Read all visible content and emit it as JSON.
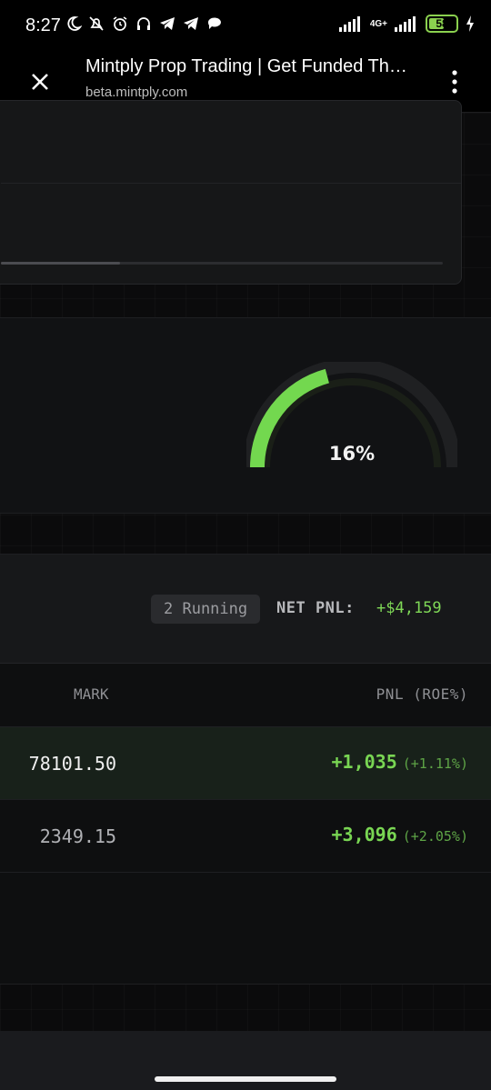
{
  "status_bar": {
    "time": "8:27",
    "battery_percent": "58",
    "network": "4G+",
    "icons": [
      "moon-icon",
      "mute-icon",
      "alarm-icon",
      "headset-icon",
      "telegram-icon",
      "telegram-icon",
      "chat-bubble-icon",
      "signal-icon",
      "signal-icon",
      "battery-icon",
      "charging-icon"
    ]
  },
  "browser": {
    "page_title": "Mintply Prop Trading | Get Funded Th…",
    "url": "beta.mintply.com",
    "icons": [
      "close-icon",
      "more-vert-icon"
    ]
  },
  "top_panel": {
    "progress_fraction": 0.27
  },
  "gauge": {
    "value_label": "16%",
    "value_fraction": 0.16,
    "accent_color": "#73d84f"
  },
  "positions": {
    "running_badge": "2 Running",
    "net_pnl_label": "NET PNL:",
    "net_pnl_value": "+$4,159",
    "columns": {
      "mark": "MARK",
      "pnl": "PNL (ROE%)"
    },
    "rows": [
      {
        "mark": "78101.50",
        "pnl": "+1,035",
        "roe": "(+1.11%)"
      },
      {
        "mark": "2349.15",
        "pnl": "+3,096",
        "roe": "(+2.05%)"
      }
    ]
  },
  "colors": {
    "profit_green": "#79d653",
    "background": "#0b0b0c"
  }
}
